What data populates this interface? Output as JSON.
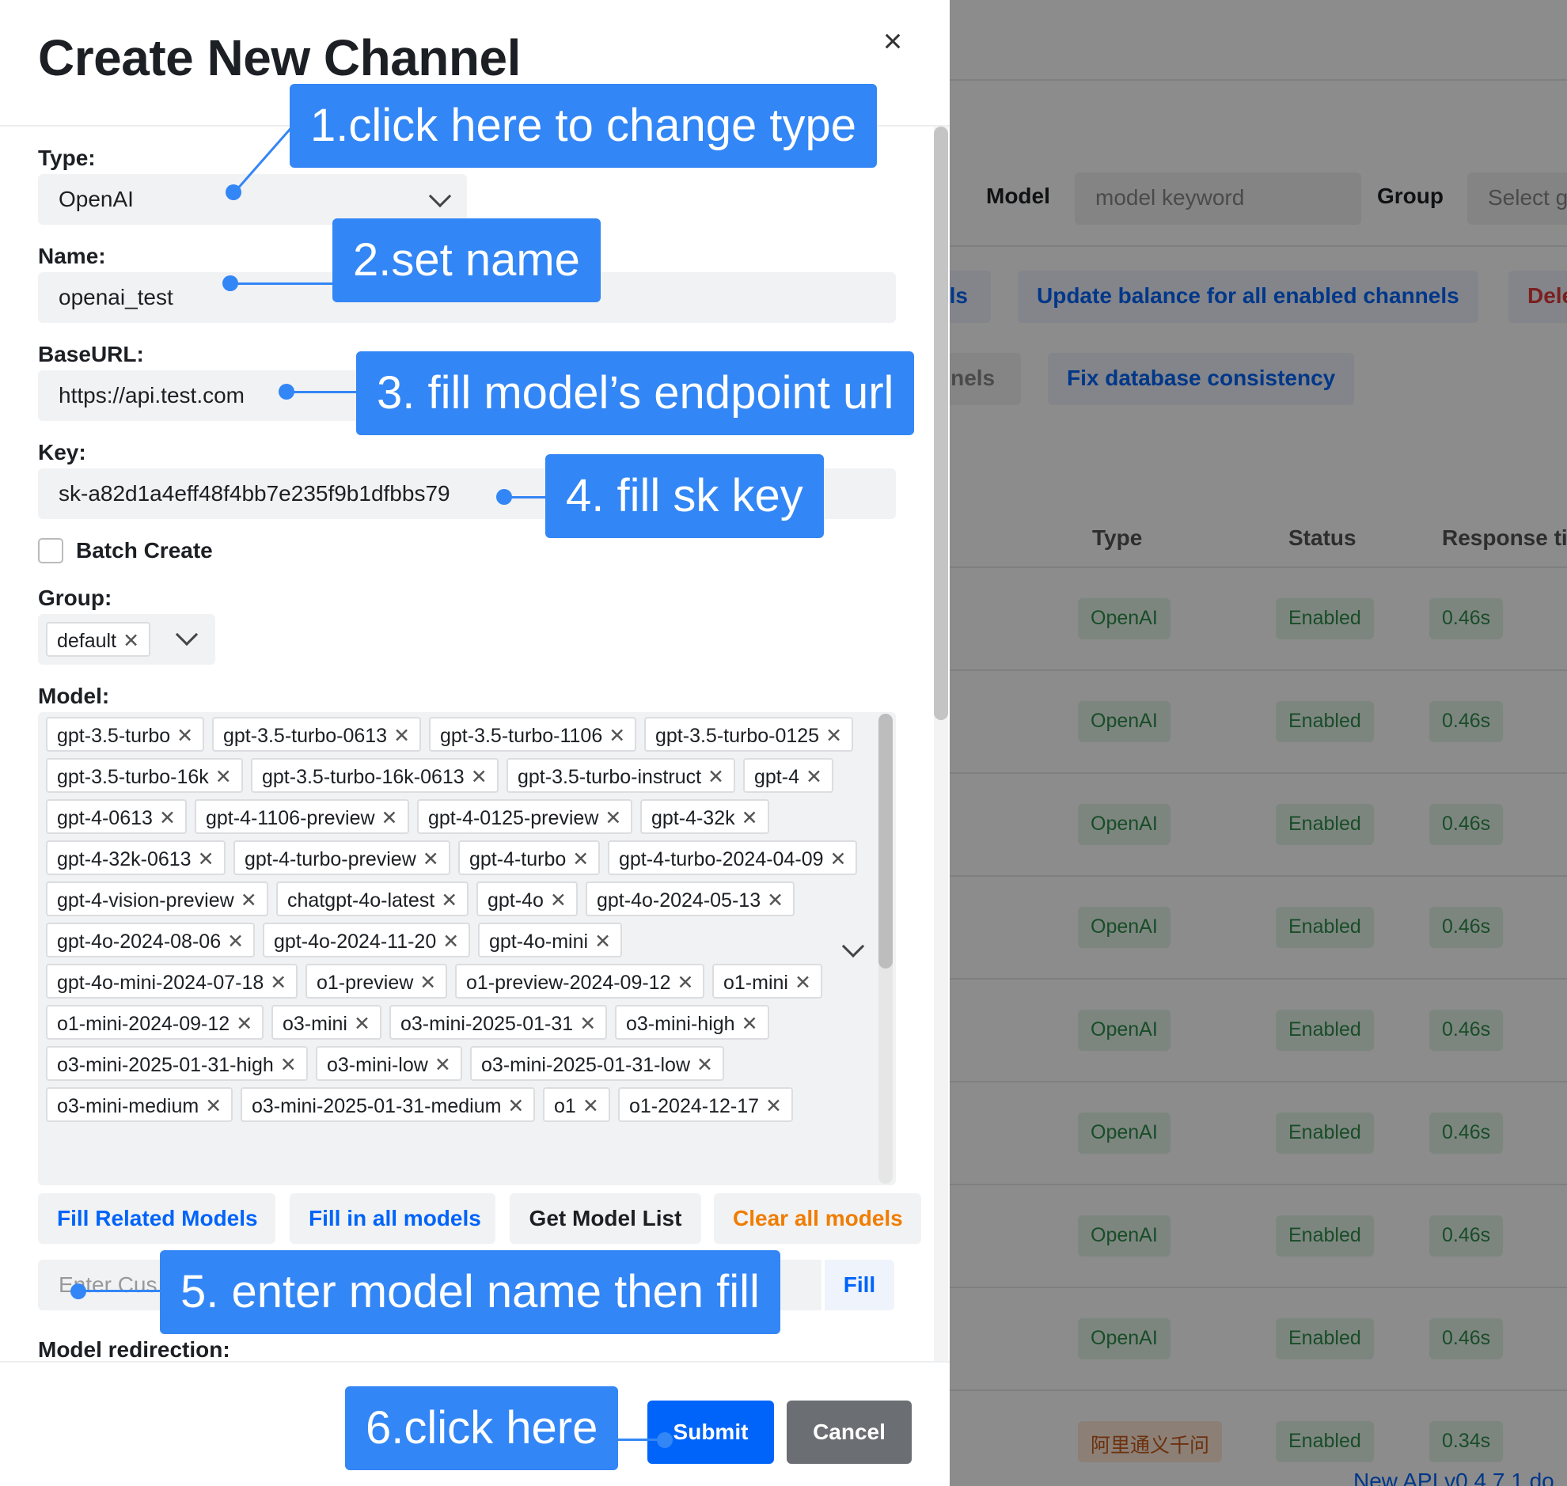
{
  "modal": {
    "title": "Create New Channel",
    "close_icon": "×",
    "type_label": "Type:",
    "type_value": "OpenAI",
    "name_label": "Name:",
    "name_value": "openai_test",
    "baseurl_label": "BaseURL:",
    "baseurl_value": "https://api.test.com",
    "key_label": "Key:",
    "key_value": "sk-a82d1a4eff48f4bb7e235f9b1dfbbs79",
    "batch_label": "Batch Create",
    "group_label": "Group:",
    "group_chips": [
      "default"
    ],
    "model_label": "Model:",
    "models": [
      "gpt-3.5-turbo",
      "gpt-3.5-turbo-0613",
      "gpt-3.5-turbo-1106",
      "gpt-3.5-turbo-0125",
      "gpt-3.5-turbo-16k",
      "gpt-3.5-turbo-16k-0613",
      "gpt-3.5-turbo-instruct",
      "gpt-4",
      "gpt-4-0613",
      "gpt-4-1106-preview",
      "gpt-4-0125-preview",
      "gpt-4-32k",
      "gpt-4-32k-0613",
      "gpt-4-turbo-preview",
      "gpt-4-turbo",
      "gpt-4-turbo-2024-04-09",
      "gpt-4-vision-preview",
      "chatgpt-4o-latest",
      "gpt-4o",
      "gpt-4o-2024-05-13",
      "gpt-4o-2024-08-06",
      "gpt-4o-2024-11-20",
      "gpt-4o-mini",
      "gpt-4o-mini-2024-07-18",
      "o1-preview",
      "o1-preview-2024-09-12",
      "o1-mini",
      "o1-mini-2024-09-12",
      "o3-mini",
      "o3-mini-2025-01-31",
      "o3-mini-high",
      "o3-mini-2025-01-31-high",
      "o3-mini-low",
      "o3-mini-2025-01-31-low",
      "o3-mini-medium",
      "o3-mini-2025-01-31-medium",
      "o1",
      "o1-2024-12-17"
    ],
    "buttons": {
      "fill_related": "Fill Related Models",
      "fill_all": "Fill in all models",
      "get_list": "Get Model List",
      "clear_all": "Clear all models",
      "fill": "Fill",
      "submit": "Submit",
      "cancel": "Cancel"
    },
    "custom_placeholder": "Enter Cus",
    "redirect_label": "Model redirection:"
  },
  "background": {
    "filter_model_label": "Model",
    "filter_model_placeholder": "model keyword",
    "filter_group_label": "Group",
    "filter_group_placeholder": "Select g",
    "btn_models_partial": "els",
    "btn_update_balance": "Update balance for all enabled channels",
    "btn_delete_partial": "Dele",
    "btn_channels_partial": "nnels",
    "btn_fix_db": "Fix database consistency",
    "col_type": "Type",
    "col_status": "Status",
    "col_response": "Response ti",
    "rows": [
      {
        "type": "OpenAI",
        "status": "Enabled",
        "response": "0.46s"
      },
      {
        "type": "OpenAI",
        "status": "Enabled",
        "response": "0.46s"
      },
      {
        "type": "OpenAI",
        "status": "Enabled",
        "response": "0.46s"
      },
      {
        "type": "OpenAI",
        "status": "Enabled",
        "response": "0.46s"
      },
      {
        "type": "OpenAI",
        "status": "Enabled",
        "response": "0.46s"
      },
      {
        "type": "OpenAI",
        "status": "Enabled",
        "response": "0.46s"
      },
      {
        "type": "OpenAI",
        "status": "Enabled",
        "response": "0.46s"
      },
      {
        "type": "OpenAI",
        "status": "Enabled",
        "response": "0.46s"
      },
      {
        "type": "阿里通义千问",
        "status": "Enabled",
        "response": "0.34s"
      }
    ],
    "footer_partial": "New API v0.4.7.1 do"
  },
  "annotations": {
    "step1": "1.click here to change type",
    "step2": "2.set name",
    "step3": "3. fill model’s endpoint url",
    "step4": "4. fill sk key",
    "step5": "5. enter model name then fill",
    "step6": "6.click here"
  },
  "colors": {
    "accent": "#0064fa",
    "callout": "#3386f5",
    "clear_orange": "#f07d00",
    "cancel_gray": "#6b6e72"
  }
}
